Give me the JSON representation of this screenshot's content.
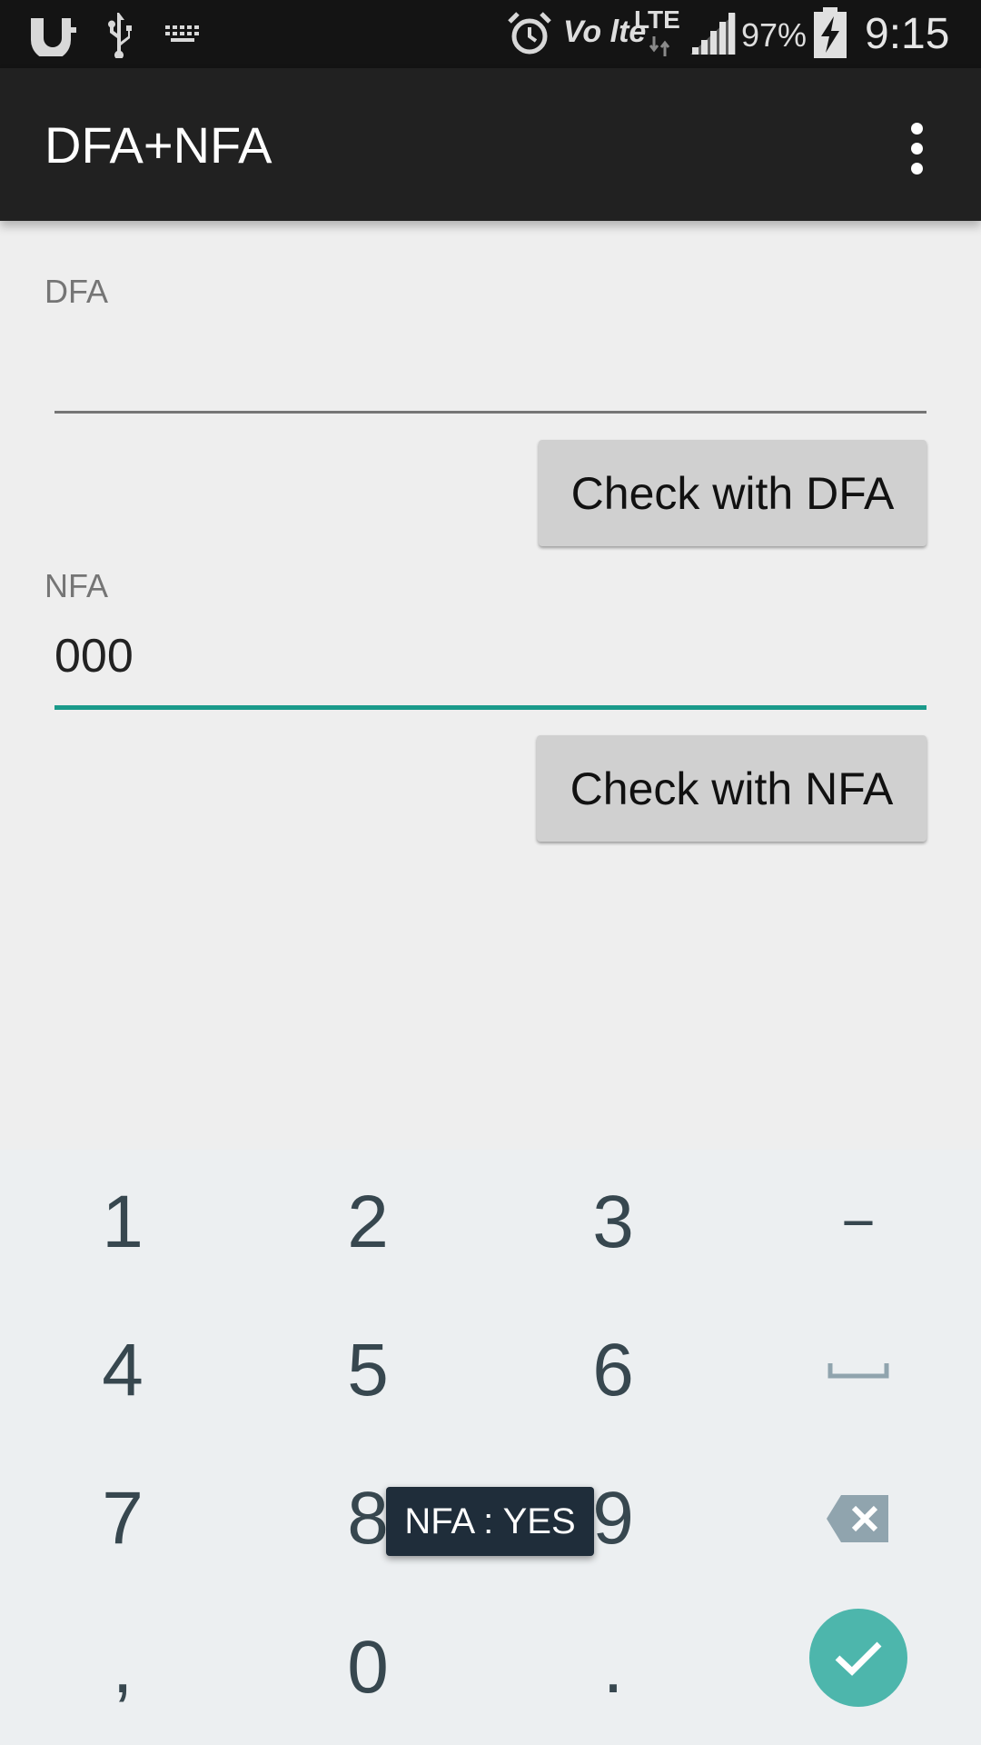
{
  "status_bar": {
    "battery": "97%",
    "time": "9:15",
    "network": "LTE",
    "volte": "Vo lte",
    "icons": [
      "uc-browser-icon",
      "usb-icon",
      "keyboard-icon",
      "alarm-icon",
      "volte-icon",
      "lte-icon",
      "signal-icon",
      "battery-charging-icon"
    ]
  },
  "app_bar": {
    "title": "DFA+NFA",
    "overflow_icon": "more-vert-icon"
  },
  "dfa": {
    "label": "DFA",
    "value": "",
    "button": "Check with DFA"
  },
  "nfa": {
    "label": "NFA",
    "value": "000",
    "button": "Check with NFA"
  },
  "keyboard": {
    "keys": [
      "1",
      "2",
      "3",
      "−",
      "4",
      "5",
      "6",
      "space",
      "7",
      "8",
      "9",
      "backspace",
      ",",
      "0",
      ".",
      "done"
    ],
    "labels": {
      "k1": "1",
      "k2": "2",
      "k3": "3",
      "minus": "−",
      "k4": "4",
      "k5": "5",
      "k6": "6",
      "k7": "7",
      "k8": "8",
      "k9": "9",
      "comma": ",",
      "k0": "0",
      "period": "."
    }
  },
  "toast": {
    "text": "NFA : YES"
  },
  "colors": {
    "accent": "#1a9a8a",
    "app_bar": "#212121",
    "done_key": "#4db6ac"
  }
}
